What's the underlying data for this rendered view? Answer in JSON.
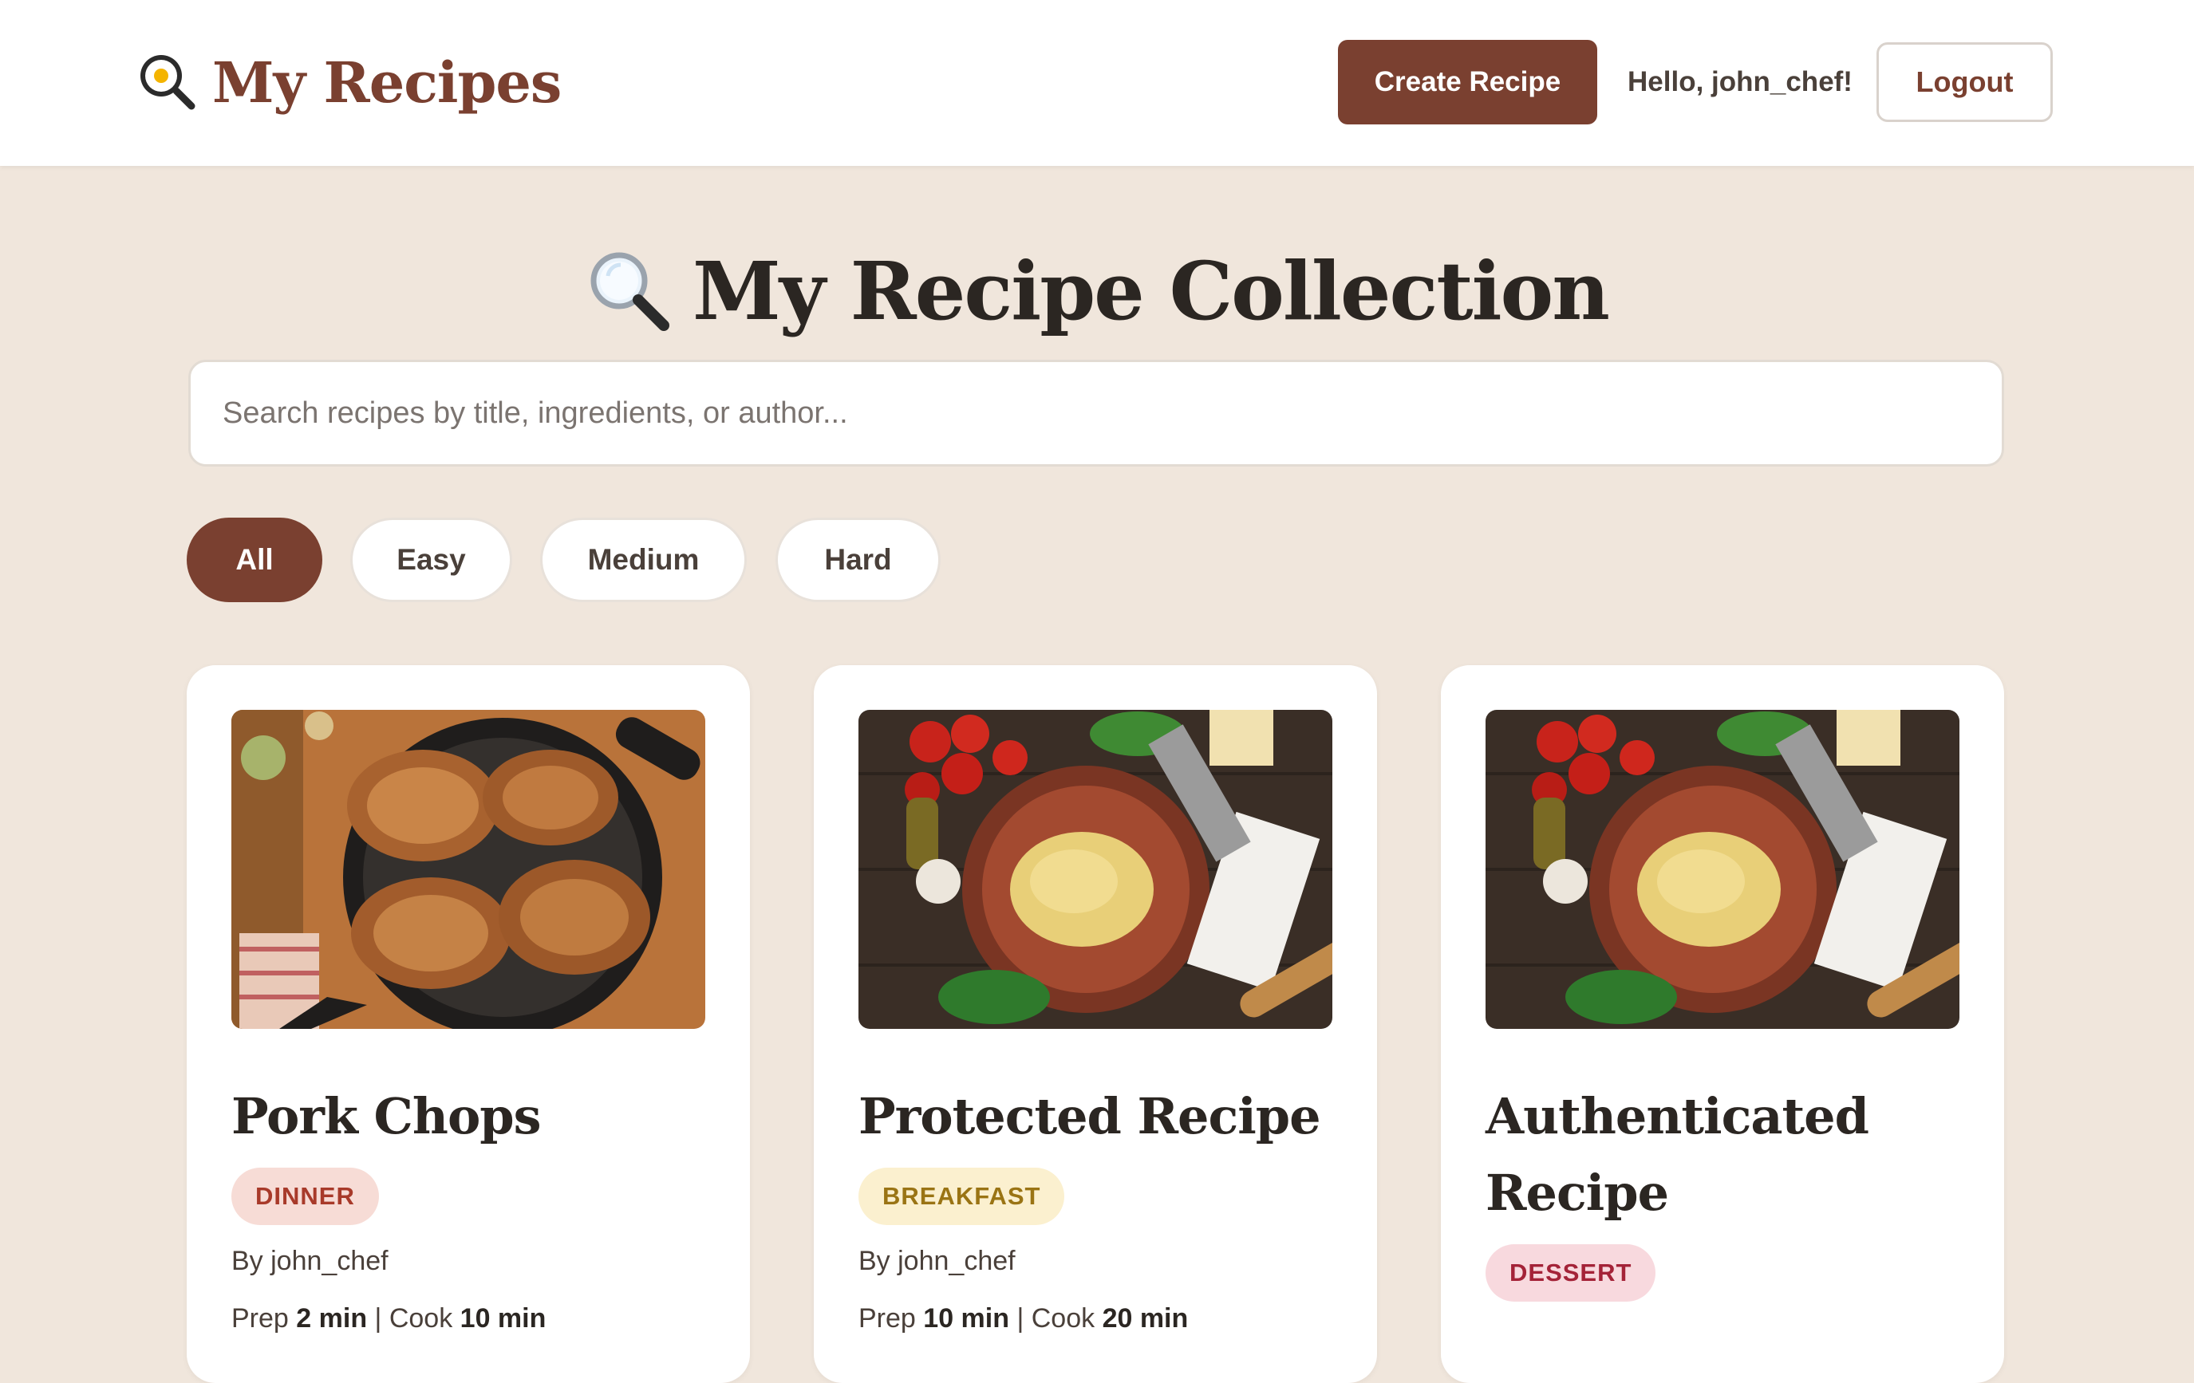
{
  "header": {
    "brand_icon": "frying-pan-egg-icon",
    "brand_title": "My Recipes",
    "create_label": "Create Recipe",
    "greeting": "Hello, john_chef!",
    "logout_label": "Logout"
  },
  "main": {
    "title_icon": "magnifying-glass-icon",
    "title": "My Recipe Collection",
    "search_placeholder": "Search recipes by title, ingredients, or author...",
    "filters": [
      "All",
      "Easy",
      "Medium",
      "Hard"
    ],
    "active_filter": "All"
  },
  "recipes": [
    {
      "title": "Pork Chops",
      "category": "DINNER",
      "author": "By john_chef",
      "prep_label": "Prep",
      "prep_value": "2 min",
      "cook_label": "Cook",
      "cook_value": "10 min",
      "image": "pork-chops-skillet-image"
    },
    {
      "title": "Protected Recipe",
      "category": "BREAKFAST",
      "author": "By john_chef",
      "prep_label": "Prep",
      "prep_value": "10 min",
      "cook_label": "Cook",
      "cook_value": "20 min",
      "image": "pasta-dough-bowl-image"
    },
    {
      "title": "Authenticated Recipe",
      "category": "DESSERT",
      "image": "pasta-dough-bowl-image"
    }
  ],
  "colors": {
    "brand": "#7a4030",
    "background": "#f0e6dc",
    "card": "#ffffff",
    "dinner_badge": "#f7dcd6",
    "breakfast_badge": "#fbf0cf",
    "dessert_badge": "#f8d9de"
  }
}
